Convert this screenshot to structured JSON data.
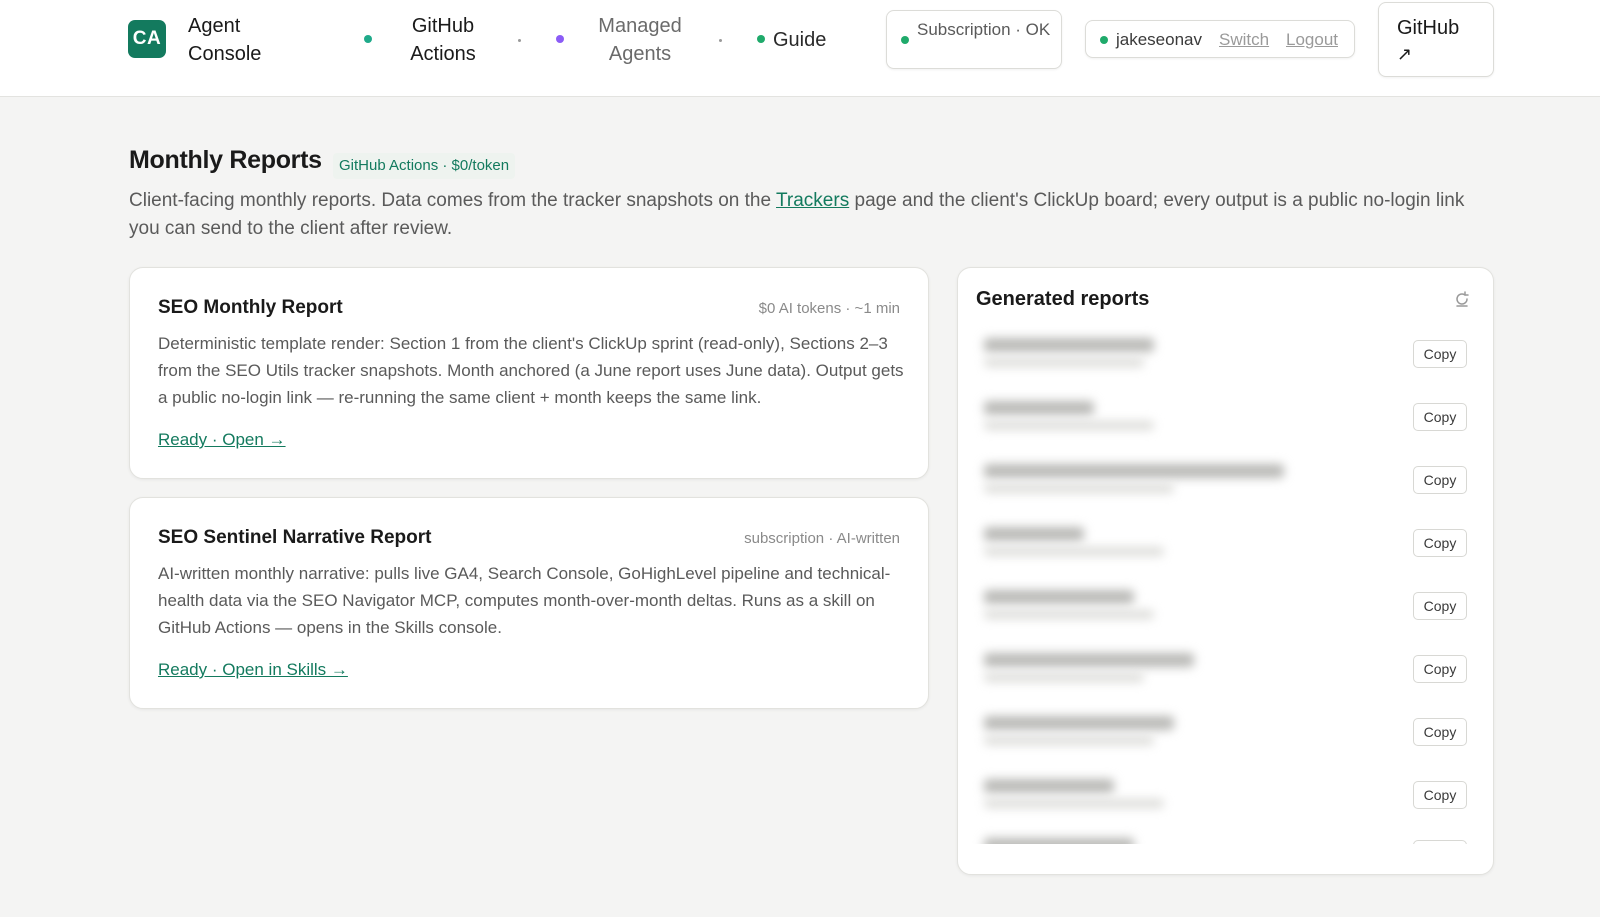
{
  "header": {
    "logo_text": "CA",
    "app_title": "Agent Console",
    "nav": [
      {
        "label": "GitHub Actions",
        "dot_color": "#1faa8a",
        "active": true
      },
      {
        "label": "Managed Agents",
        "dot_color": "#8b5cf6",
        "active": false
      },
      {
        "label": "Guide",
        "dot_color": "#1faa6b",
        "active": false
      }
    ],
    "subscription_status": "Subscription · OK",
    "user": {
      "name": "jakeseonav",
      "switch_label": "Switch",
      "logout_label": "Logout"
    },
    "github_label": "GitHub",
    "github_arrow": "↗"
  },
  "page": {
    "title": "Monthly Reports",
    "tag": "GitHub Actions · $0/token",
    "description_before": "Client-facing monthly reports. Data comes from the tracker snapshots on the ",
    "description_link": "Trackers",
    "description_after": " page and the client's ClickUp board; every output is a public no-login link you can send to the client after review."
  },
  "reports": [
    {
      "title": "SEO Monthly Report",
      "meta": "$0 AI tokens · ~1 min",
      "description": "Deterministic template render: Section 1 from the client's ClickUp sprint (read-only), Sections 2–3 from the SEO Utils tracker snapshots. Month anchored (a June report uses June data). Output gets a public no-login link — re-running the same client + month keeps the same link.",
      "status": "Ready · Open →"
    },
    {
      "title": "SEO Sentinel Narrative Report",
      "meta": "subscription · AI-written",
      "description": "AI-written monthly narrative: pulls live GA4, Search Console, GoHighLevel pipeline and technical-health data via the SEO Navigator MCP, computes month-over-month deltas. Runs as a skill on GitHub Actions — opens in the Skills console.",
      "status": "Ready · Open in Skills →"
    }
  ],
  "generated": {
    "title": "Generated reports",
    "refresh_icon": "refresh-icon",
    "copy_label": "Copy"
  },
  "colors": {
    "accent": "#137a5e",
    "status_ok": "#1faa6b",
    "purple": "#8b5cf6",
    "background": "#f4f4f3"
  }
}
